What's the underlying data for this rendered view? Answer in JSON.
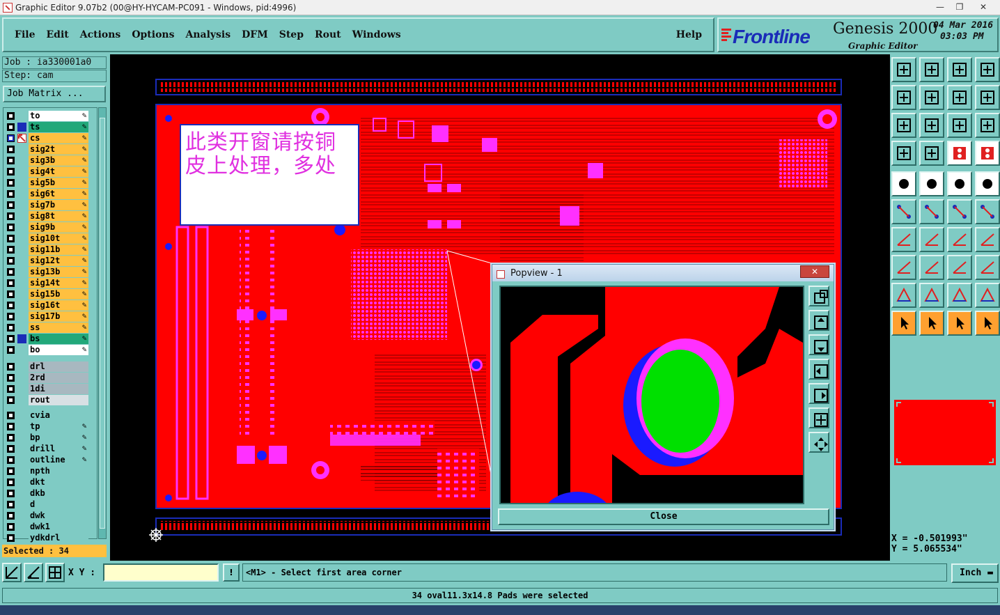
{
  "window": {
    "title": "Graphic Editor 9.07b2 (00@HY-HYCAM-PC091 - Windows, pid:4996)",
    "minimize": "—",
    "maximize": "❐",
    "close": "✕"
  },
  "menu": {
    "items": [
      "File",
      "Edit",
      "Actions",
      "Options",
      "Analysis",
      "DFM",
      "Step",
      "Rout",
      "Windows"
    ],
    "help": "Help"
  },
  "brand": {
    "logo": "Frontline",
    "product": "Genesis 2000",
    "subtitle": "Graphic Editor",
    "date": "04 Mar 2016",
    "time": "03:03 PM"
  },
  "job": {
    "job_line": "Job : ia330001a0",
    "step_line": "Step: cam",
    "matrix_button": "Job Matrix ..."
  },
  "layers": {
    "board": [
      {
        "name": "to",
        "color": "#ffffff"
      },
      {
        "name": "ts",
        "color": "#22a87a"
      },
      {
        "name": "cs",
        "color": "#ffc040"
      },
      {
        "name": "sig2t",
        "color": "#ffc040"
      },
      {
        "name": "sig3b",
        "color": "#ffc040"
      },
      {
        "name": "sig4t",
        "color": "#ffc040"
      },
      {
        "name": "sig5b",
        "color": "#ffc040"
      },
      {
        "name": "sig6t",
        "color": "#ffc040"
      },
      {
        "name": "sig7b",
        "color": "#ffc040"
      },
      {
        "name": "sig8t",
        "color": "#ffc040"
      },
      {
        "name": "sig9b",
        "color": "#ffc040"
      },
      {
        "name": "sig10t",
        "color": "#ffc040"
      },
      {
        "name": "sig11b",
        "color": "#ffc040"
      },
      {
        "name": "sig12t",
        "color": "#ffc040"
      },
      {
        "name": "sig13b",
        "color": "#ffc040"
      },
      {
        "name": "sig14t",
        "color": "#ffc040"
      },
      {
        "name": "sig15b",
        "color": "#ffc040"
      },
      {
        "name": "sig16t",
        "color": "#ffc040"
      },
      {
        "name": "sig17b",
        "color": "#ffc040"
      },
      {
        "name": "ss",
        "color": "#ffc040"
      },
      {
        "name": "bs",
        "color": "#22a87a"
      },
      {
        "name": "bo",
        "color": "#ffffff"
      }
    ],
    "drill": [
      {
        "name": "drl",
        "color": "#a8b8c0"
      },
      {
        "name": "2rd",
        "color": "#a8b8c0"
      },
      {
        "name": "1di",
        "color": "#a8b8c0"
      },
      {
        "name": "rout",
        "color": "#d8e0e4"
      }
    ],
    "misc": [
      {
        "name": "cvia",
        "color": "#7fcbc4"
      },
      {
        "name": "tp",
        "color": "#7fcbc4"
      },
      {
        "name": "bp",
        "color": "#7fcbc4"
      },
      {
        "name": "drill",
        "color": "#7fcbc4"
      },
      {
        "name": "outline",
        "color": "#7fcbc4"
      },
      {
        "name": "npth",
        "color": "#7fcbc4"
      },
      {
        "name": "dkt",
        "color": "#7fcbc4"
      },
      {
        "name": "dkb",
        "color": "#7fcbc4"
      },
      {
        "name": "d",
        "color": "#7fcbc4"
      },
      {
        "name": "dwk",
        "color": "#7fcbc4"
      },
      {
        "name": "dwk1",
        "color": "#7fcbc4"
      },
      {
        "name": "ydkdrl",
        "color": "#7fcbc4"
      }
    ]
  },
  "selected_count": "Selected : 34",
  "note": {
    "text": "此类开窗请按铜皮上处理，多处"
  },
  "popview": {
    "title": "Popview - 1",
    "close_x": "✕",
    "close_button": "Close"
  },
  "coords": {
    "x": "X = -0.501993\"",
    "y": "Y = 5.065534\""
  },
  "bottom": {
    "xy_label": "X Y :",
    "xy_value": "",
    "msg_button": "!",
    "prompt": "<M1> - Select first area corner",
    "units": "Inch"
  },
  "status": "34 oval11.3x14.8 Pads were selected",
  "colors": {
    "panel": "#7fcbc4",
    "copper": "#ff0000",
    "pad": "#ff30ff",
    "drill": "#00e000",
    "via": "#1a1aff"
  }
}
